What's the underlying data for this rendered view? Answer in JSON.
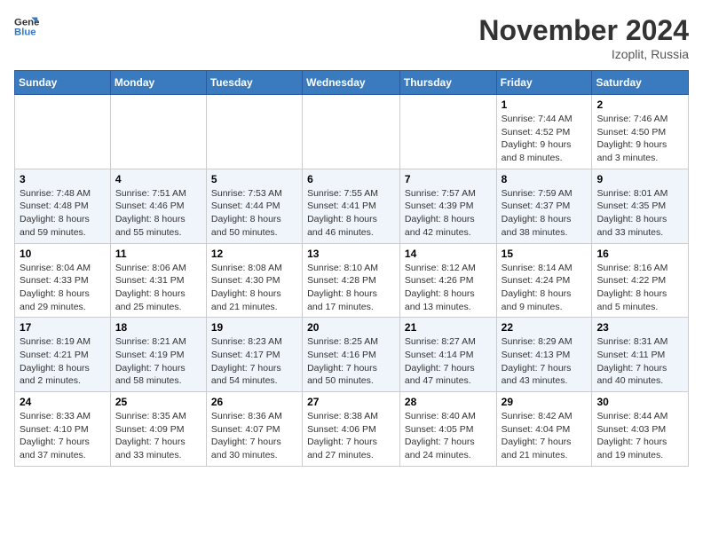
{
  "header": {
    "logo_line1": "General",
    "logo_line2": "Blue",
    "month_title": "November 2024",
    "location": "Izoplit, Russia"
  },
  "weekdays": [
    "Sunday",
    "Monday",
    "Tuesday",
    "Wednesday",
    "Thursday",
    "Friday",
    "Saturday"
  ],
  "weeks": [
    [
      {
        "day": "",
        "info": ""
      },
      {
        "day": "",
        "info": ""
      },
      {
        "day": "",
        "info": ""
      },
      {
        "day": "",
        "info": ""
      },
      {
        "day": "",
        "info": ""
      },
      {
        "day": "1",
        "info": "Sunrise: 7:44 AM\nSunset: 4:52 PM\nDaylight: 9 hours and 8 minutes."
      },
      {
        "day": "2",
        "info": "Sunrise: 7:46 AM\nSunset: 4:50 PM\nDaylight: 9 hours and 3 minutes."
      }
    ],
    [
      {
        "day": "3",
        "info": "Sunrise: 7:48 AM\nSunset: 4:48 PM\nDaylight: 8 hours and 59 minutes."
      },
      {
        "day": "4",
        "info": "Sunrise: 7:51 AM\nSunset: 4:46 PM\nDaylight: 8 hours and 55 minutes."
      },
      {
        "day": "5",
        "info": "Sunrise: 7:53 AM\nSunset: 4:44 PM\nDaylight: 8 hours and 50 minutes."
      },
      {
        "day": "6",
        "info": "Sunrise: 7:55 AM\nSunset: 4:41 PM\nDaylight: 8 hours and 46 minutes."
      },
      {
        "day": "7",
        "info": "Sunrise: 7:57 AM\nSunset: 4:39 PM\nDaylight: 8 hours and 42 minutes."
      },
      {
        "day": "8",
        "info": "Sunrise: 7:59 AM\nSunset: 4:37 PM\nDaylight: 8 hours and 38 minutes."
      },
      {
        "day": "9",
        "info": "Sunrise: 8:01 AM\nSunset: 4:35 PM\nDaylight: 8 hours and 33 minutes."
      }
    ],
    [
      {
        "day": "10",
        "info": "Sunrise: 8:04 AM\nSunset: 4:33 PM\nDaylight: 8 hours and 29 minutes."
      },
      {
        "day": "11",
        "info": "Sunrise: 8:06 AM\nSunset: 4:31 PM\nDaylight: 8 hours and 25 minutes."
      },
      {
        "day": "12",
        "info": "Sunrise: 8:08 AM\nSunset: 4:30 PM\nDaylight: 8 hours and 21 minutes."
      },
      {
        "day": "13",
        "info": "Sunrise: 8:10 AM\nSunset: 4:28 PM\nDaylight: 8 hours and 17 minutes."
      },
      {
        "day": "14",
        "info": "Sunrise: 8:12 AM\nSunset: 4:26 PM\nDaylight: 8 hours and 13 minutes."
      },
      {
        "day": "15",
        "info": "Sunrise: 8:14 AM\nSunset: 4:24 PM\nDaylight: 8 hours and 9 minutes."
      },
      {
        "day": "16",
        "info": "Sunrise: 8:16 AM\nSunset: 4:22 PM\nDaylight: 8 hours and 5 minutes."
      }
    ],
    [
      {
        "day": "17",
        "info": "Sunrise: 8:19 AM\nSunset: 4:21 PM\nDaylight: 8 hours and 2 minutes."
      },
      {
        "day": "18",
        "info": "Sunrise: 8:21 AM\nSunset: 4:19 PM\nDaylight: 7 hours and 58 minutes."
      },
      {
        "day": "19",
        "info": "Sunrise: 8:23 AM\nSunset: 4:17 PM\nDaylight: 7 hours and 54 minutes."
      },
      {
        "day": "20",
        "info": "Sunrise: 8:25 AM\nSunset: 4:16 PM\nDaylight: 7 hours and 50 minutes."
      },
      {
        "day": "21",
        "info": "Sunrise: 8:27 AM\nSunset: 4:14 PM\nDaylight: 7 hours and 47 minutes."
      },
      {
        "day": "22",
        "info": "Sunrise: 8:29 AM\nSunset: 4:13 PM\nDaylight: 7 hours and 43 minutes."
      },
      {
        "day": "23",
        "info": "Sunrise: 8:31 AM\nSunset: 4:11 PM\nDaylight: 7 hours and 40 minutes."
      }
    ],
    [
      {
        "day": "24",
        "info": "Sunrise: 8:33 AM\nSunset: 4:10 PM\nDaylight: 7 hours and 37 minutes."
      },
      {
        "day": "25",
        "info": "Sunrise: 8:35 AM\nSunset: 4:09 PM\nDaylight: 7 hours and 33 minutes."
      },
      {
        "day": "26",
        "info": "Sunrise: 8:36 AM\nSunset: 4:07 PM\nDaylight: 7 hours and 30 minutes."
      },
      {
        "day": "27",
        "info": "Sunrise: 8:38 AM\nSunset: 4:06 PM\nDaylight: 7 hours and 27 minutes."
      },
      {
        "day": "28",
        "info": "Sunrise: 8:40 AM\nSunset: 4:05 PM\nDaylight: 7 hours and 24 minutes."
      },
      {
        "day": "29",
        "info": "Sunrise: 8:42 AM\nSunset: 4:04 PM\nDaylight: 7 hours and 21 minutes."
      },
      {
        "day": "30",
        "info": "Sunrise: 8:44 AM\nSunset: 4:03 PM\nDaylight: 7 hours and 19 minutes."
      }
    ]
  ]
}
